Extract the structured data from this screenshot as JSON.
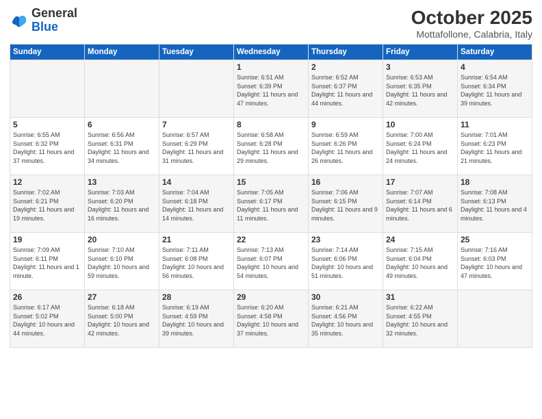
{
  "logo": {
    "general": "General",
    "blue": "Blue"
  },
  "title": "October 2025",
  "subtitle": "Mottafollone, Calabria, Italy",
  "days_header": [
    "Sunday",
    "Monday",
    "Tuesday",
    "Wednesday",
    "Thursday",
    "Friday",
    "Saturday"
  ],
  "weeks": [
    [
      {
        "day": "",
        "info": ""
      },
      {
        "day": "",
        "info": ""
      },
      {
        "day": "",
        "info": ""
      },
      {
        "day": "1",
        "info": "Sunrise: 6:51 AM\nSunset: 6:39 PM\nDaylight: 11 hours and 47 minutes."
      },
      {
        "day": "2",
        "info": "Sunrise: 6:52 AM\nSunset: 6:37 PM\nDaylight: 11 hours and 44 minutes."
      },
      {
        "day": "3",
        "info": "Sunrise: 6:53 AM\nSunset: 6:35 PM\nDaylight: 11 hours and 42 minutes."
      },
      {
        "day": "4",
        "info": "Sunrise: 6:54 AM\nSunset: 6:34 PM\nDaylight: 11 hours and 39 minutes."
      }
    ],
    [
      {
        "day": "5",
        "info": "Sunrise: 6:55 AM\nSunset: 6:32 PM\nDaylight: 11 hours and 37 minutes."
      },
      {
        "day": "6",
        "info": "Sunrise: 6:56 AM\nSunset: 6:31 PM\nDaylight: 11 hours and 34 minutes."
      },
      {
        "day": "7",
        "info": "Sunrise: 6:57 AM\nSunset: 6:29 PM\nDaylight: 11 hours and 31 minutes."
      },
      {
        "day": "8",
        "info": "Sunrise: 6:58 AM\nSunset: 6:28 PM\nDaylight: 11 hours and 29 minutes."
      },
      {
        "day": "9",
        "info": "Sunrise: 6:59 AM\nSunset: 6:26 PM\nDaylight: 11 hours and 26 minutes."
      },
      {
        "day": "10",
        "info": "Sunrise: 7:00 AM\nSunset: 6:24 PM\nDaylight: 11 hours and 24 minutes."
      },
      {
        "day": "11",
        "info": "Sunrise: 7:01 AM\nSunset: 6:23 PM\nDaylight: 11 hours and 21 minutes."
      }
    ],
    [
      {
        "day": "12",
        "info": "Sunrise: 7:02 AM\nSunset: 6:21 PM\nDaylight: 11 hours and 19 minutes."
      },
      {
        "day": "13",
        "info": "Sunrise: 7:03 AM\nSunset: 6:20 PM\nDaylight: 11 hours and 16 minutes."
      },
      {
        "day": "14",
        "info": "Sunrise: 7:04 AM\nSunset: 6:18 PM\nDaylight: 11 hours and 14 minutes."
      },
      {
        "day": "15",
        "info": "Sunrise: 7:05 AM\nSunset: 6:17 PM\nDaylight: 11 hours and 11 minutes."
      },
      {
        "day": "16",
        "info": "Sunrise: 7:06 AM\nSunset: 6:15 PM\nDaylight: 11 hours and 9 minutes."
      },
      {
        "day": "17",
        "info": "Sunrise: 7:07 AM\nSunset: 6:14 PM\nDaylight: 11 hours and 6 minutes."
      },
      {
        "day": "18",
        "info": "Sunrise: 7:08 AM\nSunset: 6:13 PM\nDaylight: 11 hours and 4 minutes."
      }
    ],
    [
      {
        "day": "19",
        "info": "Sunrise: 7:09 AM\nSunset: 6:11 PM\nDaylight: 11 hours and 1 minute."
      },
      {
        "day": "20",
        "info": "Sunrise: 7:10 AM\nSunset: 6:10 PM\nDaylight: 10 hours and 59 minutes."
      },
      {
        "day": "21",
        "info": "Sunrise: 7:11 AM\nSunset: 6:08 PM\nDaylight: 10 hours and 56 minutes."
      },
      {
        "day": "22",
        "info": "Sunrise: 7:13 AM\nSunset: 6:07 PM\nDaylight: 10 hours and 54 minutes."
      },
      {
        "day": "23",
        "info": "Sunrise: 7:14 AM\nSunset: 6:06 PM\nDaylight: 10 hours and 51 minutes."
      },
      {
        "day": "24",
        "info": "Sunrise: 7:15 AM\nSunset: 6:04 PM\nDaylight: 10 hours and 49 minutes."
      },
      {
        "day": "25",
        "info": "Sunrise: 7:16 AM\nSunset: 6:03 PM\nDaylight: 10 hours and 47 minutes."
      }
    ],
    [
      {
        "day": "26",
        "info": "Sunrise: 6:17 AM\nSunset: 5:02 PM\nDaylight: 10 hours and 44 minutes."
      },
      {
        "day": "27",
        "info": "Sunrise: 6:18 AM\nSunset: 5:00 PM\nDaylight: 10 hours and 42 minutes."
      },
      {
        "day": "28",
        "info": "Sunrise: 6:19 AM\nSunset: 4:59 PM\nDaylight: 10 hours and 39 minutes."
      },
      {
        "day": "29",
        "info": "Sunrise: 6:20 AM\nSunset: 4:58 PM\nDaylight: 10 hours and 37 minutes."
      },
      {
        "day": "30",
        "info": "Sunrise: 6:21 AM\nSunset: 4:56 PM\nDaylight: 10 hours and 35 minutes."
      },
      {
        "day": "31",
        "info": "Sunrise: 6:22 AM\nSunset: 4:55 PM\nDaylight: 10 hours and 32 minutes."
      },
      {
        "day": "",
        "info": ""
      }
    ]
  ]
}
